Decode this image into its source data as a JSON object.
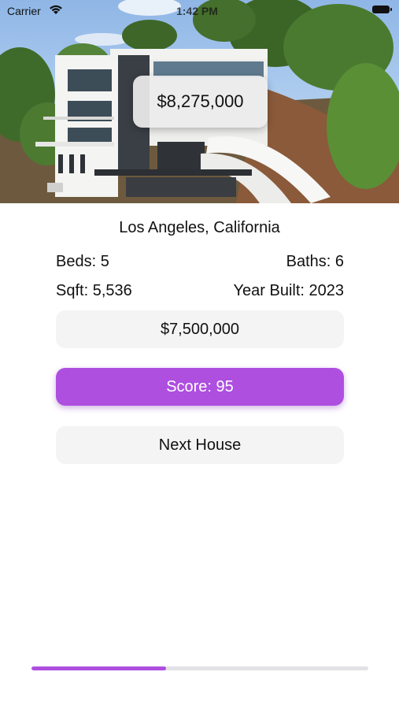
{
  "status_bar": {
    "carrier": "Carrier",
    "time": "1:42 PM",
    "wifi_icon": "wifi-icon",
    "battery_icon": "battery-icon"
  },
  "listing": {
    "actual_price": "$8,275,000",
    "location": "Los Angeles, California",
    "beds": "Beds: 5",
    "baths": "Baths: 6",
    "sqft": "Sqft: 5,536",
    "year_built": "Year Built: 2023"
  },
  "guess": {
    "value": "$7,500,000"
  },
  "score_button": {
    "label": "Score: 95"
  },
  "next_button": {
    "label": "Next House"
  },
  "progress": {
    "fraction": 0.4
  },
  "colors": {
    "accent": "#ae4fe0",
    "pill_background": "#f4f4f5"
  }
}
